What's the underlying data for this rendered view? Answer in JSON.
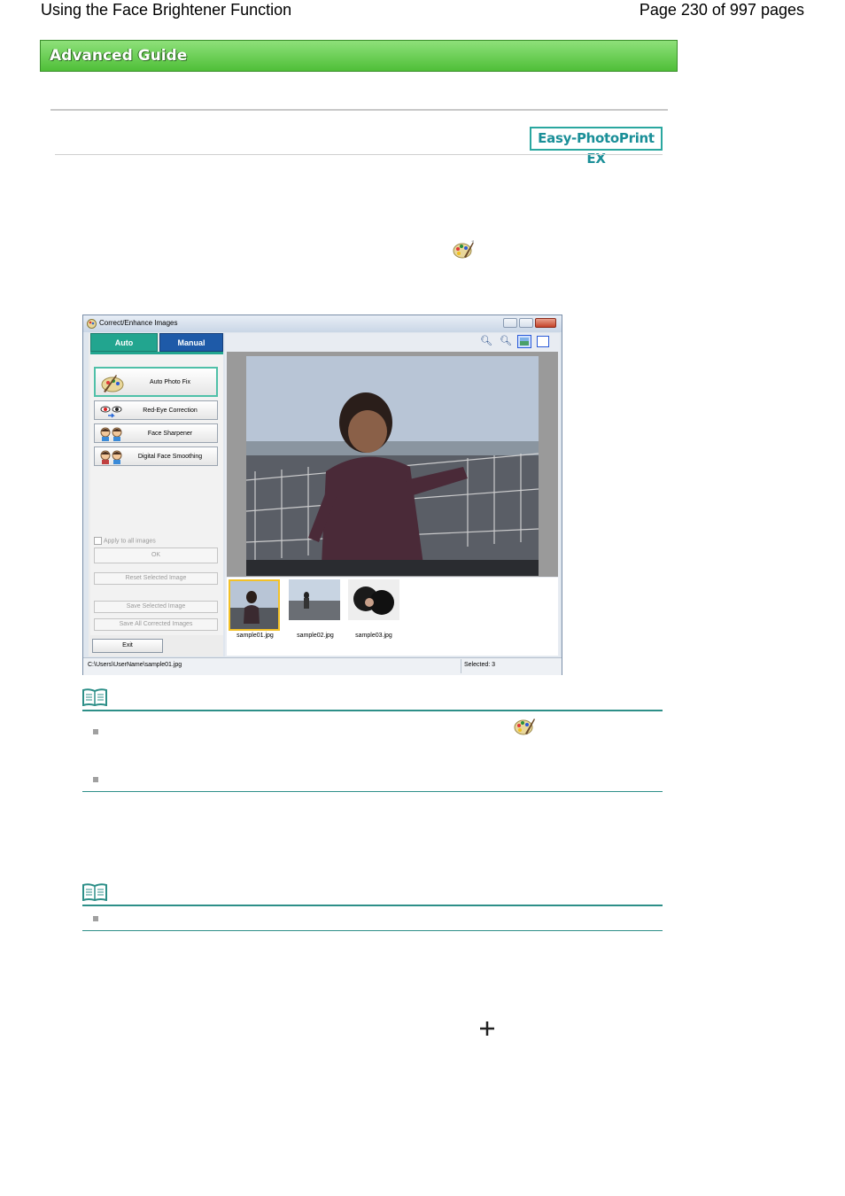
{
  "header": {
    "title": "Using the Face Brightener Function",
    "page": "Page 230 of 997 pages"
  },
  "banner": {
    "label": "Advanced Guide"
  },
  "product_badge": {
    "label": "Easy-PhotoPrint EX"
  },
  "window": {
    "title": "Correct/Enhance Images",
    "tabs": {
      "auto": "Auto",
      "manual": "Manual"
    },
    "buttons": {
      "auto_photo_fix": "Auto Photo Fix",
      "red_eye": "Red-Eye Correction",
      "face_sharpener": "Face Sharpener",
      "digital_face_smoothing": "Digital Face Smoothing"
    },
    "apply_all": "Apply to all images",
    "ok": "OK",
    "reset": "Reset Selected Image",
    "save_selected": "Save Selected Image",
    "save_all": "Save All Corrected Images",
    "exit": "Exit",
    "thumbnails": [
      "sample01.jpg",
      "sample02.jpg",
      "sample03.jpg"
    ],
    "status_path": "C:\\Users\\UserName\\sample01.jpg",
    "status_selected": "Selected: 3"
  },
  "colors": {
    "banner_green": "#4fbf38",
    "auto_tab": "#22a58f",
    "manual_tab": "#1e5aa8",
    "note_rule": "#2d8f88"
  },
  "icons": [
    "palette-brush-icon",
    "note-book-icon",
    "plus-icon"
  ]
}
